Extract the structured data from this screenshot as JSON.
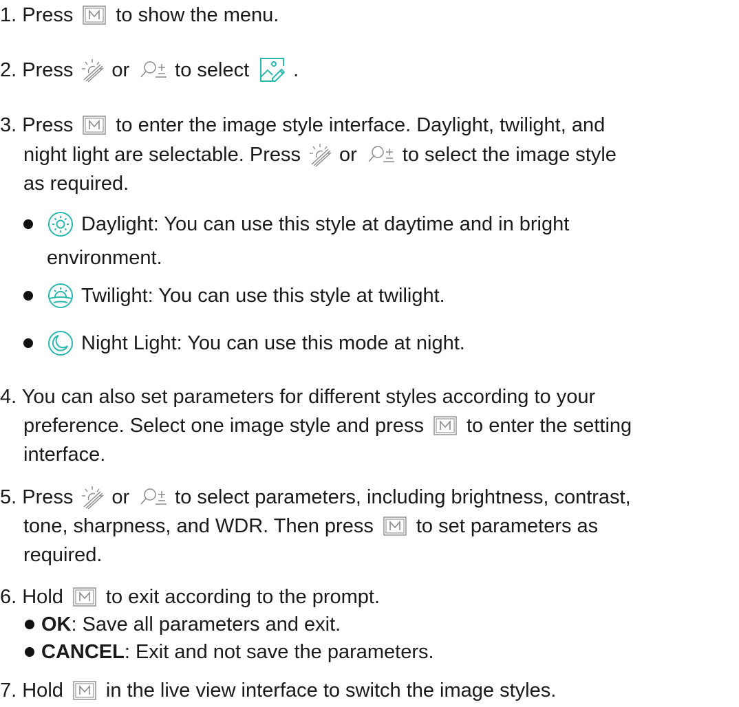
{
  "step1": {
    "num": "1. Press",
    "text": "to show the menu."
  },
  "step2": {
    "num": "2. Press",
    "or": "or",
    "text": "to select",
    "end": "."
  },
  "step3": {
    "line1a": "3. Press",
    "line1b": "to enter the image style interface. Daylight, twilight, and",
    "line2a": "night light are selectable. Press",
    "line2b": "or",
    "line2c": "to select the image style",
    "line3": "as required."
  },
  "styles": [
    {
      "icon": "sun-icon",
      "text": "Daylight: You can use this style at daytime and in bright",
      "cont": "environment."
    },
    {
      "icon": "twilight-icon",
      "text": "Twilight: You can use this style at twilight."
    },
    {
      "icon": "moon-icon",
      "text": "Night Light: You can use this mode at night."
    }
  ],
  "step4": {
    "line1": "4. You can also set parameters for different styles according to your",
    "line2a": "preference. Select one image style and press",
    "line2b": "to enter the setting",
    "line3": "interface."
  },
  "step5": {
    "line1a": "5. Press",
    "line1b": "or",
    "line1c": "to select parameters, including brightness, contrast,",
    "line2a": "tone, sharpness, and WDR. Then press",
    "line2b": "to set parameters as",
    "line3": "required."
  },
  "step6": {
    "line1a": "6. Hold",
    "line1b": "to exit according to the prompt.",
    "ok_label": "OK",
    "ok_text": ": Save all parameters and exit.",
    "cancel_label": "CANCEL",
    "cancel_text": ": Exit and not save the parameters."
  },
  "step7": {
    "a": "7. Hold",
    "b": "in the live view interface to switch the image styles."
  },
  "colors": {
    "text": "#1a1a1a",
    "accent": "#2bb8ad",
    "icon_gray": "#888888"
  }
}
